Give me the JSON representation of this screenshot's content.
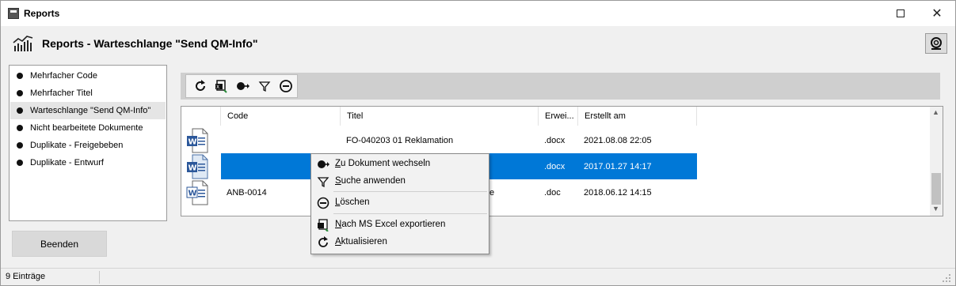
{
  "window": {
    "title": "Reports"
  },
  "header": {
    "title": "Reports - Warteschlange \"Send QM-Info\""
  },
  "nav": {
    "items": [
      {
        "label": "Mehrfacher Code"
      },
      {
        "label": "Mehrfacher Titel"
      },
      {
        "label": "Warteschlange \"Send QM-Info\"",
        "selected": true
      },
      {
        "label": "Nicht bearbeitete Dokumente"
      },
      {
        "label": "Duplikate - Freigebeben"
      },
      {
        "label": "Duplikate - Entwurf"
      }
    ]
  },
  "buttons": {
    "end_label": "Beenden"
  },
  "grid": {
    "columns": [
      "Code",
      "Titel",
      "Erwei...",
      "Erstellt am"
    ],
    "rows": [
      {
        "icon": "word-docx-icon",
        "code": "",
        "title": "FO-040203 01 Reklamation",
        "ext": ".docx",
        "created": "2021.08.08 22:05",
        "selected": false
      },
      {
        "icon": "word-docx-icon",
        "code": "",
        "title": "",
        "ext": ".docx",
        "created": "2017.01.27 14:17",
        "selected": true
      },
      {
        "icon": "word-doc-icon",
        "code": "ANB-0014",
        "title": "e",
        "ext": ".doc",
        "created": "2018.06.12 14:15",
        "selected": false
      }
    ]
  },
  "context_menu": {
    "items": [
      {
        "label_hot": "Z",
        "label_rest": "u Dokument wechseln",
        "icon": "goto-document-icon"
      },
      {
        "label_hot": "S",
        "label_rest": "uche anwenden",
        "icon": "filter-icon"
      },
      {
        "label_hot": "L",
        "label_rest": "öschen",
        "icon": "delete-icon"
      },
      {
        "label_hot": "N",
        "label_rest": "ach MS Excel exportieren",
        "icon": "excel-export-icon"
      },
      {
        "label_hot": "A",
        "label_rest": "ktualisieren",
        "icon": "refresh-icon"
      }
    ]
  },
  "status": {
    "count_text": "9 Einträge"
  },
  "colors": {
    "selection": "#0078d7",
    "word_blue": "#2b579a",
    "toolbar_bg": "#cfcfcf"
  }
}
